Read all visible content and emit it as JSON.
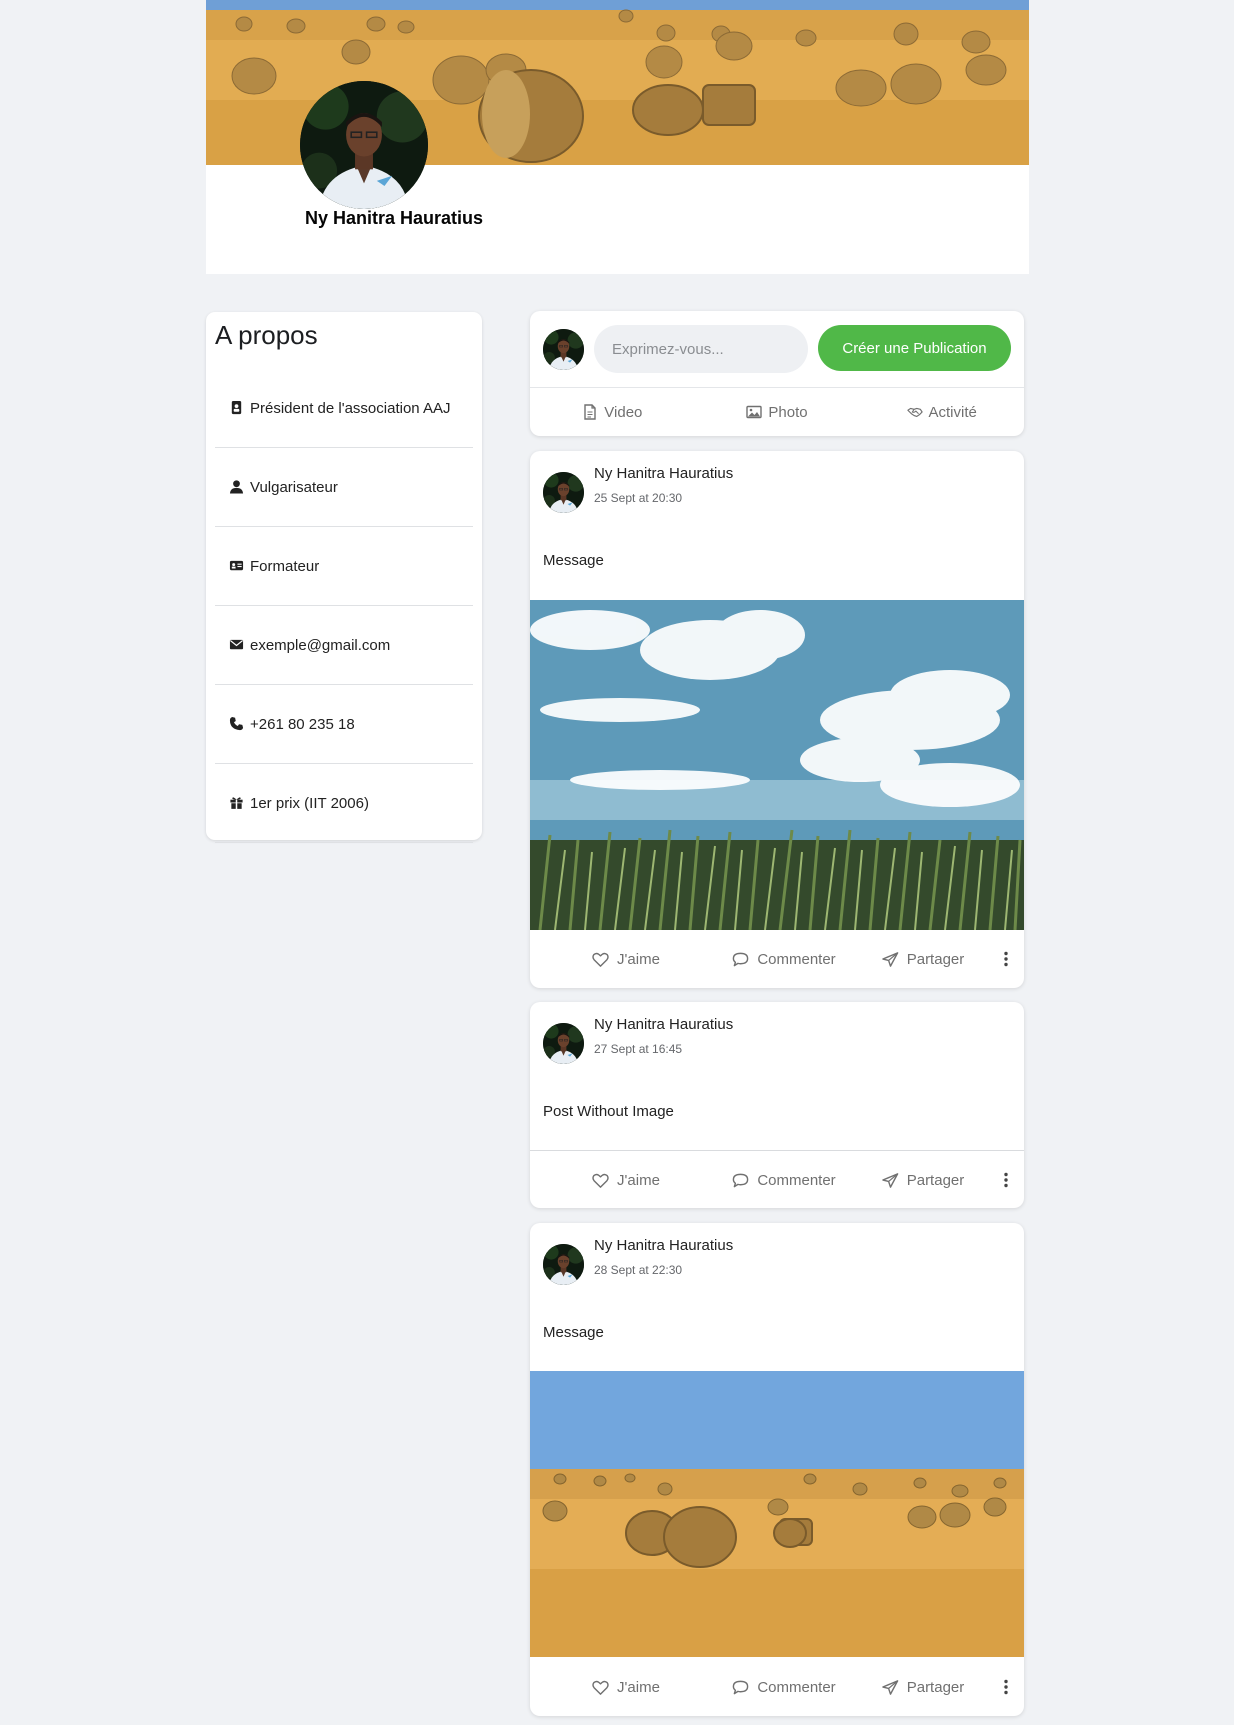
{
  "profile": {
    "name": "Ny Hanitra Hauratius"
  },
  "about": {
    "title": "A propos",
    "items": [
      {
        "icon": "id-badge-icon",
        "text": "Président de l'association AAJ"
      },
      {
        "icon": "user-icon",
        "text": "Vulgarisateur"
      },
      {
        "icon": "id-card-icon",
        "text": "Formateur"
      },
      {
        "icon": "envelope-icon",
        "text": "exemple@gmail.com"
      },
      {
        "icon": "phone-icon",
        "text": "+261 80 235 18"
      },
      {
        "icon": "gift-icon",
        "text": "1er prix (IIT 2006)"
      }
    ]
  },
  "composer": {
    "placeholder": "Exprimez-vous...",
    "create_label": "Créer une Publication",
    "actions": [
      {
        "icon": "file-icon",
        "label": "Video"
      },
      {
        "icon": "image-icon",
        "label": "Photo"
      },
      {
        "icon": "handshake-icon",
        "label": "Activité"
      }
    ]
  },
  "post_actions": {
    "like": "J'aime",
    "comment": "Commenter",
    "share": "Partager"
  },
  "posts": [
    {
      "author": "Ny Hanitra Hauratius",
      "time": "25 Sept at 20:30",
      "text": "Message",
      "image": "sky-cornfield-photo"
    },
    {
      "author": "Ny Hanitra Hauratius",
      "time": "27 Sept at 16:45",
      "text": "Post Without Image",
      "image": ""
    },
    {
      "author": "Ny Hanitra Hauratius",
      "time": "28 Sept at 22:30",
      "text": "Message",
      "image": "hay-bales-field-photo"
    }
  ],
  "colors": {
    "accent": "#50b848",
    "page_background": "#f0f2f5",
    "card_background": "#ffffff",
    "muted_text": "#707070"
  }
}
